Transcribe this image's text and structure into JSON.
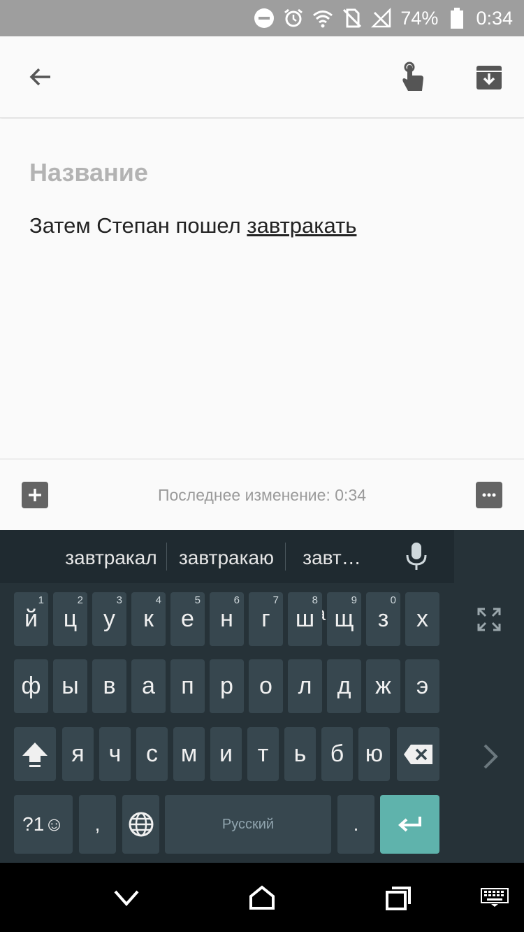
{
  "status_bar": {
    "battery_text": "74%",
    "time": "0:34",
    "icons": [
      "do-not-disturb-icon",
      "alarm-icon",
      "wifi-icon",
      "no-sim-icon",
      "signal-icon",
      "battery-icon"
    ]
  },
  "app_bar": {
    "icons": [
      "back-arrow-icon",
      "touch-icon",
      "archive-icon"
    ]
  },
  "note": {
    "title_placeholder": "Название",
    "body_plain": "Затем Степан пошел ",
    "body_underlined": "завтракать"
  },
  "toolbar": {
    "status": "Последнее изменение: 0:34",
    "icons": [
      "add-icon",
      "more-icon"
    ]
  },
  "keyboard": {
    "suggestions": [
      "завтракал",
      "завтракаю",
      "завт…ают"
    ],
    "row1": [
      {
        "label": "й",
        "hint": "1"
      },
      {
        "label": "ц",
        "hint": "2"
      },
      {
        "label": "у",
        "hint": "3"
      },
      {
        "label": "к",
        "hint": "4"
      },
      {
        "label": "е",
        "hint": "5"
      },
      {
        "label": "н",
        "hint": "6"
      },
      {
        "label": "г",
        "hint": "7"
      },
      {
        "label": "ш",
        "hint": "8"
      },
      {
        "label": "щ",
        "hint": "9"
      },
      {
        "label": "з",
        "hint": "0"
      },
      {
        "label": "х",
        "hint": ""
      }
    ],
    "row2": [
      "ф",
      "ы",
      "в",
      "а",
      "п",
      "р",
      "о",
      "л",
      "д",
      "ж",
      "э"
    ],
    "row3": [
      "я",
      "ч",
      "с",
      "м",
      "и",
      "т",
      "ь",
      "б",
      "ю"
    ],
    "symbols_label": "?1☺",
    "comma_label": ",",
    "space_label": "Русский",
    "period_label": ".",
    "colors": {
      "background": "#263238",
      "key": "#37474f",
      "enter": "#5fb3ac"
    }
  },
  "nav_bar": {
    "icons": [
      "back-chevron-icon",
      "home-icon",
      "recents-icon",
      "keyboard-icon"
    ]
  }
}
